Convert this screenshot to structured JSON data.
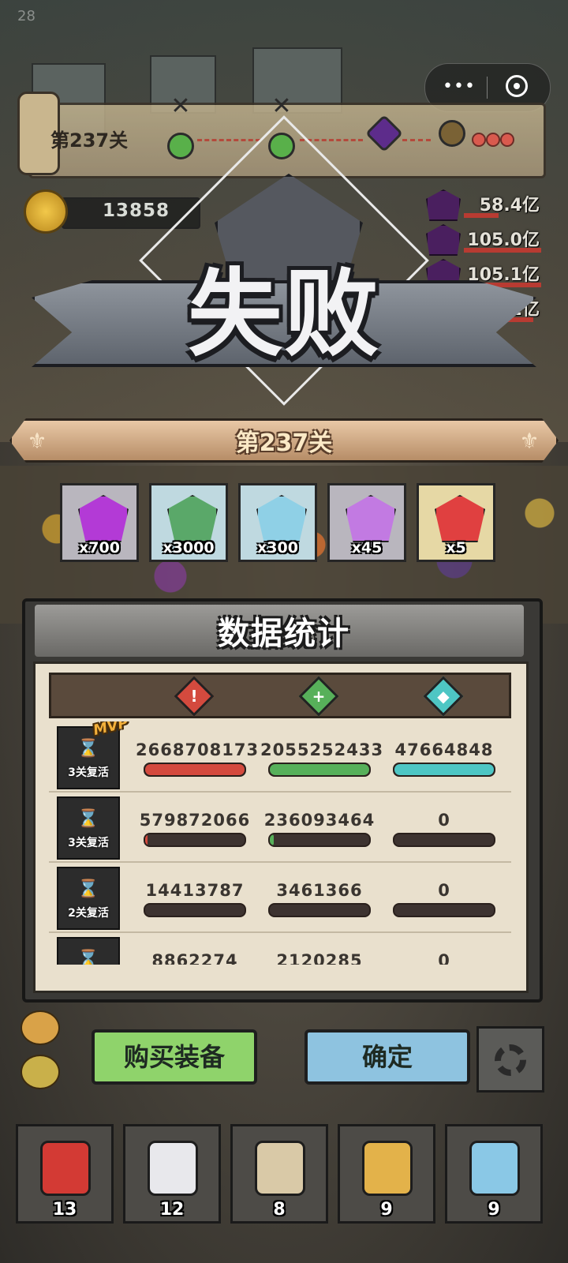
{
  "status_bar": {
    "fps": "28"
  },
  "capsule": {
    "more_icon": "more-dots-icon",
    "close_icon": "target-circle-icon"
  },
  "progress": {
    "level": "第237关"
  },
  "coins": {
    "value": "13858"
  },
  "enemies": [
    {
      "hp": "58.4亿",
      "bar": 0.45
    },
    {
      "hp": "105.0亿",
      "bar": 1.0
    },
    {
      "hp": "105.1亿",
      "bar": 1.0
    },
    {
      "hp": "93.2亿",
      "bar": 0.9
    }
  ],
  "result": {
    "title": "失败",
    "level": "第237关"
  },
  "rewards": [
    {
      "icon": "purple-gem-icon",
      "qty": "x700",
      "bg": "#b9b6be",
      "color": "#b33ad6"
    },
    {
      "icon": "green-ticket-icon",
      "qty": "x3000",
      "bg": "#bfd9e0",
      "color": "#5aa869"
    },
    {
      "icon": "crystal-shard-icon",
      "qty": "x300",
      "bg": "#bfd9e0",
      "color": "#8fd0e6"
    },
    {
      "icon": "violet-crystal-icon",
      "qty": "x45",
      "bg": "#b9b6be",
      "color": "#c27ae2"
    },
    {
      "icon": "cube-core-icon",
      "qty": "x5",
      "bg": "#e6d8a5",
      "color": "#e04040"
    }
  ],
  "stats": {
    "title": "数据统计",
    "columns": [
      {
        "icon": "sword-damage-icon",
        "color": "#d44a3e"
      },
      {
        "icon": "heal-plus-icon",
        "color": "#57b05a"
      },
      {
        "icon": "shield-icon",
        "color": "#4ec6c4"
      }
    ],
    "rows": [
      {
        "mvp": "MVP",
        "revive": "3关复活",
        "damage": "2668708173",
        "heal": "2055252433",
        "shield": "47664848",
        "fills": [
          1.0,
          1.0,
          1.0
        ]
      },
      {
        "mvp": "",
        "revive": "3关复活",
        "damage": "579872066",
        "heal": "236093464",
        "shield": "0",
        "fills": [
          0.02,
          0.04,
          0.0
        ]
      },
      {
        "mvp": "",
        "revive": "2关复活",
        "damage": "14413787",
        "heal": "3461366",
        "shield": "0",
        "fills": [
          0.0,
          0.0,
          0.0
        ]
      },
      {
        "mvp": "",
        "revive": "",
        "damage": "8862274",
        "heal": "2120285",
        "shield": "0",
        "fills": [
          0.0,
          0.0,
          0.0
        ]
      }
    ]
  },
  "buttons": {
    "buy": "购买装备",
    "confirm": "确定",
    "settings_icon": "gear-icon"
  },
  "inventory": [
    {
      "icon": "cola-can-icon",
      "count": "13"
    },
    {
      "icon": "first-aid-kit-icon",
      "count": "12"
    },
    {
      "icon": "scroll-quill-icon",
      "count": "8"
    },
    {
      "icon": "lightning-card-icon",
      "count": "9"
    },
    {
      "icon": "nuke-rocket-icon",
      "count": "9"
    }
  ]
}
